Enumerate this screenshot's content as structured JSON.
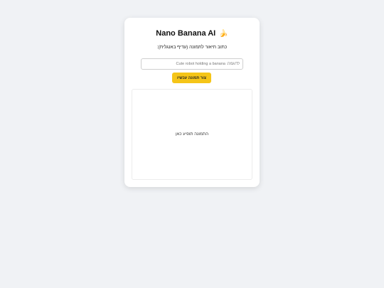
{
  "app": {
    "title": "Nano Banana AI",
    "title_emoji": "🍌"
  },
  "prompt": {
    "instruction": "כתוב תיאור לתמונה (עדיף באנגלית):",
    "input_value": "",
    "input_placeholder": "לדוגמה: Cute robot holding a banana"
  },
  "actions": {
    "generate_label": "צור תמונה עכשיו"
  },
  "result": {
    "placeholder": "התמונה תופיע כאן"
  },
  "colors": {
    "background": "#f0f2f5",
    "card": "#ffffff",
    "accent": "#f5c518"
  }
}
